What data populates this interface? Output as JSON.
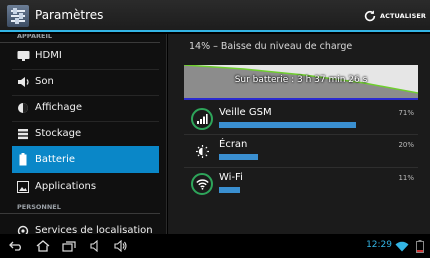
{
  "actionbar": {
    "title": "Paramètres",
    "refresh_label": "ACTUALISER",
    "app_icon": "settings-sliders-icon",
    "refresh_icon": "refresh-icon"
  },
  "sidebar": {
    "section_appareil": "APPAREIL",
    "section_personnel": "PERSONNEL",
    "items": [
      {
        "label": "HDMI",
        "icon": "monitor-icon"
      },
      {
        "label": "Son",
        "icon": "speaker-icon"
      },
      {
        "label": "Affichage",
        "icon": "brightness-icon"
      },
      {
        "label": "Stockage",
        "icon": "storage-icon"
      },
      {
        "label": "Batterie",
        "icon": "battery-icon",
        "selected": true
      },
      {
        "label": "Applications",
        "icon": "applications-icon"
      },
      {
        "label": "Services de localisation",
        "icon": "location-icon"
      }
    ]
  },
  "battery": {
    "status": "14% – Baisse du niveau de charge",
    "graph_label": "Sur batterie : 3 h 37 min 26 s",
    "usage": [
      {
        "name": "Veille GSM",
        "percent": "71%",
        "value": 71,
        "icon": "cell-signal-icon"
      },
      {
        "name": "Écran",
        "percent": "20%",
        "value": 20,
        "icon": "brightness-icon"
      },
      {
        "name": "Wi-Fi",
        "percent": "11%",
        "value": 11,
        "icon": "wifi-icon"
      }
    ]
  },
  "systembar": {
    "time": "12:29",
    "buttons": [
      "back-icon",
      "home-icon",
      "recent-apps-icon",
      "volume-down-icon",
      "volume-up-icon"
    ],
    "status_icons": [
      "wifi-status-icon",
      "battery-status-icon"
    ]
  },
  "colors": {
    "accent": "#33b5e5",
    "selected_item": "#0a87c8",
    "usage_bar": "#3a8fd0",
    "icon_ring": "#2ea55a"
  }
}
